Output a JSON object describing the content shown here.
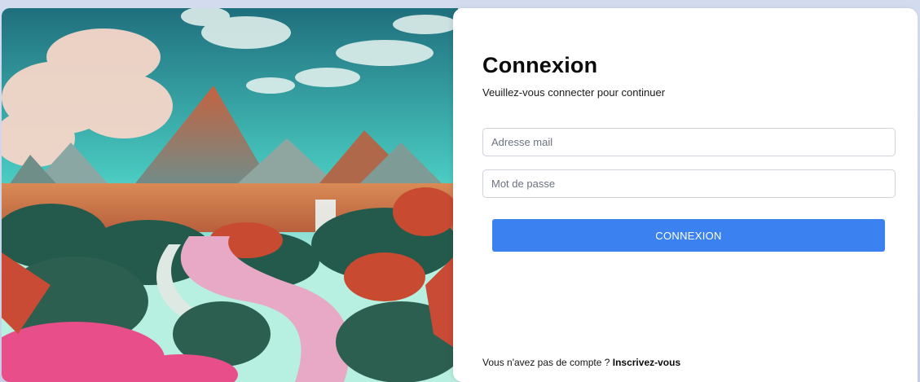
{
  "login": {
    "title": "Connexion",
    "subtitle": "Veuillez-vous connecter pour continuer",
    "email_placeholder": "Adresse mail",
    "password_placeholder": "Mot de passe",
    "submit_label": "CONNEXION",
    "signup_prompt": "Vous n'avez pas de compte ?",
    "signup_link": "Inscrivez-vous"
  },
  "colors": {
    "accent": "#3b82f0",
    "panel_bg": "#ffffff",
    "page_bg": "#c9d3ea"
  },
  "image": {
    "icon": "fantasy-landscape-illustration"
  }
}
